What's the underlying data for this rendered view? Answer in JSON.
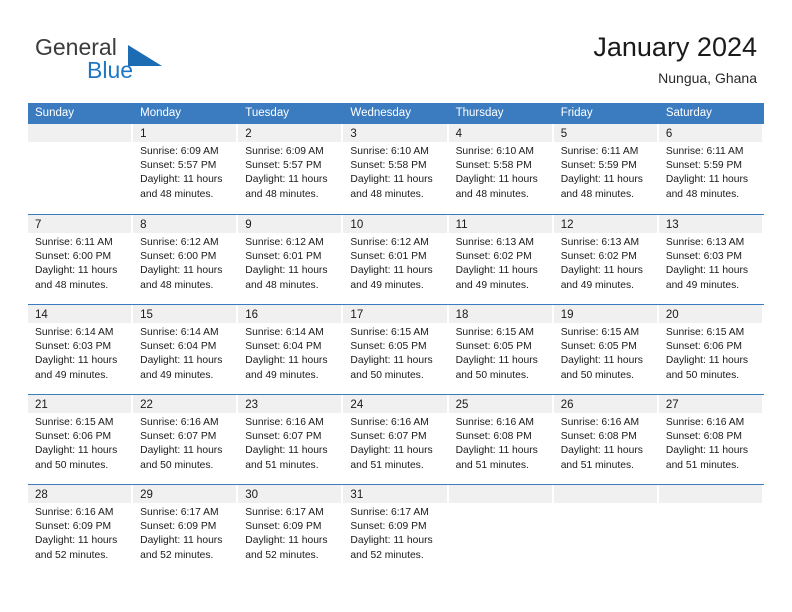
{
  "brand": {
    "word1": "General",
    "word2": "Blue",
    "logo_icon": "triangle-logo-icon",
    "accent_color": "#1b6cb3"
  },
  "header": {
    "title": "January 2024",
    "subtitle": "Nungua, Ghana"
  },
  "theme": {
    "header_blue": "#3b7cc0",
    "daynum_bg": "#f0f0f0",
    "text": "#1a1a1a"
  },
  "weekdays": [
    "Sunday",
    "Monday",
    "Tuesday",
    "Wednesday",
    "Thursday",
    "Friday",
    "Saturday"
  ],
  "weeks": [
    [
      {
        "day": ""
      },
      {
        "day": "1",
        "sunrise": "Sunrise: 6:09 AM",
        "sunset": "Sunset: 5:57 PM",
        "daylight1": "Daylight: 11 hours",
        "daylight2": "and 48 minutes."
      },
      {
        "day": "2",
        "sunrise": "Sunrise: 6:09 AM",
        "sunset": "Sunset: 5:57 PM",
        "daylight1": "Daylight: 11 hours",
        "daylight2": "and 48 minutes."
      },
      {
        "day": "3",
        "sunrise": "Sunrise: 6:10 AM",
        "sunset": "Sunset: 5:58 PM",
        "daylight1": "Daylight: 11 hours",
        "daylight2": "and 48 minutes."
      },
      {
        "day": "4",
        "sunrise": "Sunrise: 6:10 AM",
        "sunset": "Sunset: 5:58 PM",
        "daylight1": "Daylight: 11 hours",
        "daylight2": "and 48 minutes."
      },
      {
        "day": "5",
        "sunrise": "Sunrise: 6:11 AM",
        "sunset": "Sunset: 5:59 PM",
        "daylight1": "Daylight: 11 hours",
        "daylight2": "and 48 minutes."
      },
      {
        "day": "6",
        "sunrise": "Sunrise: 6:11 AM",
        "sunset": "Sunset: 5:59 PM",
        "daylight1": "Daylight: 11 hours",
        "daylight2": "and 48 minutes."
      }
    ],
    [
      {
        "day": "7",
        "sunrise": "Sunrise: 6:11 AM",
        "sunset": "Sunset: 6:00 PM",
        "daylight1": "Daylight: 11 hours",
        "daylight2": "and 48 minutes."
      },
      {
        "day": "8",
        "sunrise": "Sunrise: 6:12 AM",
        "sunset": "Sunset: 6:00 PM",
        "daylight1": "Daylight: 11 hours",
        "daylight2": "and 48 minutes."
      },
      {
        "day": "9",
        "sunrise": "Sunrise: 6:12 AM",
        "sunset": "Sunset: 6:01 PM",
        "daylight1": "Daylight: 11 hours",
        "daylight2": "and 48 minutes."
      },
      {
        "day": "10",
        "sunrise": "Sunrise: 6:12 AM",
        "sunset": "Sunset: 6:01 PM",
        "daylight1": "Daylight: 11 hours",
        "daylight2": "and 49 minutes."
      },
      {
        "day": "11",
        "sunrise": "Sunrise: 6:13 AM",
        "sunset": "Sunset: 6:02 PM",
        "daylight1": "Daylight: 11 hours",
        "daylight2": "and 49 minutes."
      },
      {
        "day": "12",
        "sunrise": "Sunrise: 6:13 AM",
        "sunset": "Sunset: 6:02 PM",
        "daylight1": "Daylight: 11 hours",
        "daylight2": "and 49 minutes."
      },
      {
        "day": "13",
        "sunrise": "Sunrise: 6:13 AM",
        "sunset": "Sunset: 6:03 PM",
        "daylight1": "Daylight: 11 hours",
        "daylight2": "and 49 minutes."
      }
    ],
    [
      {
        "day": "14",
        "sunrise": "Sunrise: 6:14 AM",
        "sunset": "Sunset: 6:03 PM",
        "daylight1": "Daylight: 11 hours",
        "daylight2": "and 49 minutes."
      },
      {
        "day": "15",
        "sunrise": "Sunrise: 6:14 AM",
        "sunset": "Sunset: 6:04 PM",
        "daylight1": "Daylight: 11 hours",
        "daylight2": "and 49 minutes."
      },
      {
        "day": "16",
        "sunrise": "Sunrise: 6:14 AM",
        "sunset": "Sunset: 6:04 PM",
        "daylight1": "Daylight: 11 hours",
        "daylight2": "and 49 minutes."
      },
      {
        "day": "17",
        "sunrise": "Sunrise: 6:15 AM",
        "sunset": "Sunset: 6:05 PM",
        "daylight1": "Daylight: 11 hours",
        "daylight2": "and 50 minutes."
      },
      {
        "day": "18",
        "sunrise": "Sunrise: 6:15 AM",
        "sunset": "Sunset: 6:05 PM",
        "daylight1": "Daylight: 11 hours",
        "daylight2": "and 50 minutes."
      },
      {
        "day": "19",
        "sunrise": "Sunrise: 6:15 AM",
        "sunset": "Sunset: 6:05 PM",
        "daylight1": "Daylight: 11 hours",
        "daylight2": "and 50 minutes."
      },
      {
        "day": "20",
        "sunrise": "Sunrise: 6:15 AM",
        "sunset": "Sunset: 6:06 PM",
        "daylight1": "Daylight: 11 hours",
        "daylight2": "and 50 minutes."
      }
    ],
    [
      {
        "day": "21",
        "sunrise": "Sunrise: 6:15 AM",
        "sunset": "Sunset: 6:06 PM",
        "daylight1": "Daylight: 11 hours",
        "daylight2": "and 50 minutes."
      },
      {
        "day": "22",
        "sunrise": "Sunrise: 6:16 AM",
        "sunset": "Sunset: 6:07 PM",
        "daylight1": "Daylight: 11 hours",
        "daylight2": "and 50 minutes."
      },
      {
        "day": "23",
        "sunrise": "Sunrise: 6:16 AM",
        "sunset": "Sunset: 6:07 PM",
        "daylight1": "Daylight: 11 hours",
        "daylight2": "and 51 minutes."
      },
      {
        "day": "24",
        "sunrise": "Sunrise: 6:16 AM",
        "sunset": "Sunset: 6:07 PM",
        "daylight1": "Daylight: 11 hours",
        "daylight2": "and 51 minutes."
      },
      {
        "day": "25",
        "sunrise": "Sunrise: 6:16 AM",
        "sunset": "Sunset: 6:08 PM",
        "daylight1": "Daylight: 11 hours",
        "daylight2": "and 51 minutes."
      },
      {
        "day": "26",
        "sunrise": "Sunrise: 6:16 AM",
        "sunset": "Sunset: 6:08 PM",
        "daylight1": "Daylight: 11 hours",
        "daylight2": "and 51 minutes."
      },
      {
        "day": "27",
        "sunrise": "Sunrise: 6:16 AM",
        "sunset": "Sunset: 6:08 PM",
        "daylight1": "Daylight: 11 hours",
        "daylight2": "and 51 minutes."
      }
    ],
    [
      {
        "day": "28",
        "sunrise": "Sunrise: 6:16 AM",
        "sunset": "Sunset: 6:09 PM",
        "daylight1": "Daylight: 11 hours",
        "daylight2": "and 52 minutes."
      },
      {
        "day": "29",
        "sunrise": "Sunrise: 6:17 AM",
        "sunset": "Sunset: 6:09 PM",
        "daylight1": "Daylight: 11 hours",
        "daylight2": "and 52 minutes."
      },
      {
        "day": "30",
        "sunrise": "Sunrise: 6:17 AM",
        "sunset": "Sunset: 6:09 PM",
        "daylight1": "Daylight: 11 hours",
        "daylight2": "and 52 minutes."
      },
      {
        "day": "31",
        "sunrise": "Sunrise: 6:17 AM",
        "sunset": "Sunset: 6:09 PM",
        "daylight1": "Daylight: 11 hours",
        "daylight2": "and 52 minutes."
      },
      {
        "day": ""
      },
      {
        "day": ""
      },
      {
        "day": ""
      }
    ]
  ]
}
